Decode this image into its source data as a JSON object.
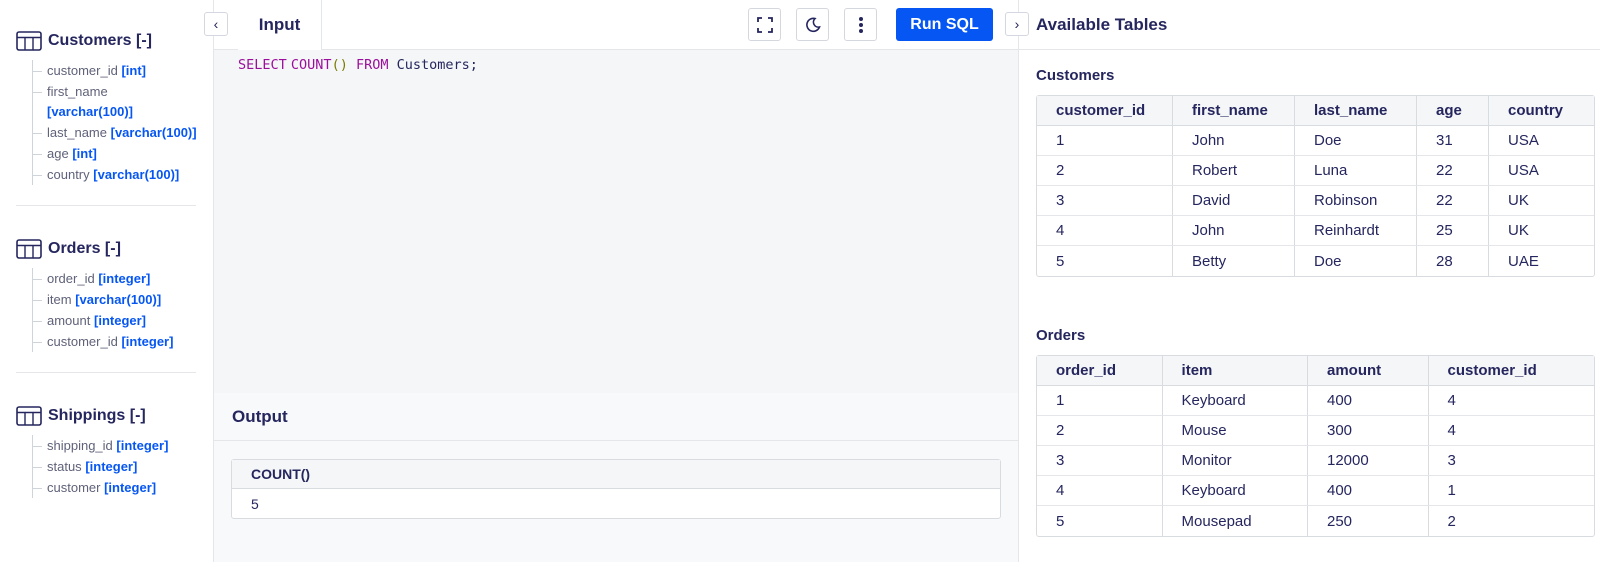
{
  "sidebar": {
    "schemas": [
      {
        "title": "Customers [-]",
        "fields": [
          {
            "name": "customer_id",
            "type": "[int]"
          },
          {
            "name": "first_name",
            "type": "[varchar(100)]"
          },
          {
            "name": "last_name",
            "type": "[varchar(100)]"
          },
          {
            "name": "age",
            "type": "[int]"
          },
          {
            "name": "country",
            "type": "[varchar(100)]"
          }
        ]
      },
      {
        "title": "Orders [-]",
        "fields": [
          {
            "name": "order_id",
            "type": "[integer]"
          },
          {
            "name": "item",
            "type": "[varchar(100)]"
          },
          {
            "name": "amount",
            "type": "[integer]"
          },
          {
            "name": "customer_id",
            "type": "[integer]"
          }
        ]
      },
      {
        "title": "Shippings [-]",
        "fields": [
          {
            "name": "shipping_id",
            "type": "[integer]"
          },
          {
            "name": "status",
            "type": "[integer]"
          },
          {
            "name": "customer",
            "type": "[integer]"
          }
        ]
      }
    ]
  },
  "editor": {
    "tab_label": "Input",
    "run_label": "Run SQL",
    "code": {
      "kw_select": "SELECT",
      "fn_count": "COUNT",
      "parens": "()",
      "kw_from": "FROM",
      "table": "Customers;"
    }
  },
  "output": {
    "title": "Output",
    "header": "COUNT()",
    "value": "5"
  },
  "right_panel": {
    "title": "Available Tables",
    "customers": {
      "title": "Customers",
      "columns": [
        "customer_id",
        "first_name",
        "last_name",
        "age",
        "country"
      ],
      "rows": [
        [
          "1",
          "John",
          "Doe",
          "31",
          "USA"
        ],
        [
          "2",
          "Robert",
          "Luna",
          "22",
          "USA"
        ],
        [
          "3",
          "David",
          "Robinson",
          "22",
          "UK"
        ],
        [
          "4",
          "John",
          "Reinhardt",
          "25",
          "UK"
        ],
        [
          "5",
          "Betty",
          "Doe",
          "28",
          "UAE"
        ]
      ]
    },
    "orders": {
      "title": "Orders",
      "columns": [
        "order_id",
        "item",
        "amount",
        "customer_id"
      ],
      "rows": [
        [
          "1",
          "Keyboard",
          "400",
          "4"
        ],
        [
          "2",
          "Mouse",
          "300",
          "4"
        ],
        [
          "3",
          "Monitor",
          "12000",
          "3"
        ],
        [
          "4",
          "Keyboard",
          "400",
          "1"
        ],
        [
          "5",
          "Mousepad",
          "250",
          "2"
        ]
      ]
    }
  },
  "colors": {
    "accent": "#0556f3",
    "text": "#25265e",
    "keyword": "#9b0f9c"
  }
}
